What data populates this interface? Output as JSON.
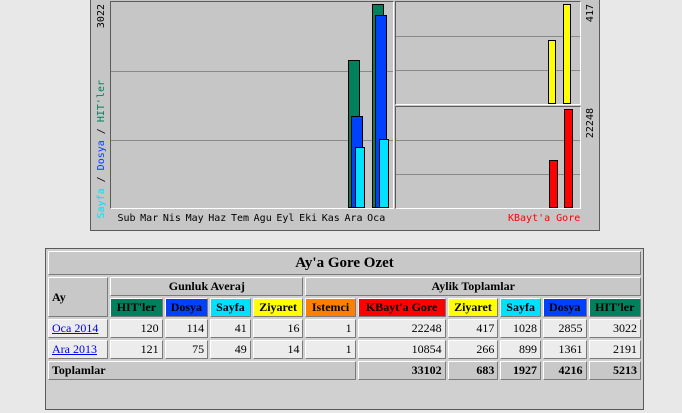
{
  "chart": {
    "months": [
      "Sub",
      "Mar",
      "Nis",
      "May",
      "Haz",
      "Tem",
      "Agu",
      "Eyl",
      "Eki",
      "Kas",
      "Ara",
      "Oca"
    ],
    "left_scale_label": "3022",
    "right_top_scale_label": "417",
    "right_bottom_scale_label": "22248",
    "legend_sayfa": "Sayfa",
    "legend_sep1": " / ",
    "legend_dosya": "Dosya",
    "legend_sep2": " / ",
    "legend_hits": "HIT'ler",
    "legend_kbyte": "KBayt'a Gore"
  },
  "chart_data": [
    {
      "type": "bar",
      "categories": [
        "Ara 2013",
        "Oca 2014"
      ],
      "series": [
        {
          "name": "HIT'ler",
          "values": [
            2191,
            3022
          ],
          "color": "#00805c"
        },
        {
          "name": "Dosya",
          "values": [
            1361,
            2855
          ],
          "color": "#0040ff"
        },
        {
          "name": "Sayfa",
          "values": [
            899,
            1028
          ],
          "color": "#00e0ff"
        }
      ],
      "ylim": [
        0,
        3022
      ]
    },
    {
      "type": "bar",
      "categories": [
        "Ara 2013",
        "Oca 2014"
      ],
      "series": [
        {
          "name": "Ziyaret",
          "values": [
            266,
            417
          ],
          "color": "#ffff00"
        }
      ],
      "ylim": [
        0,
        417
      ]
    },
    {
      "type": "bar",
      "categories": [
        "Ara 2013",
        "Oca 2014"
      ],
      "series": [
        {
          "name": "KBayt'a Gore",
          "values": [
            10854,
            22248
          ],
          "color": "#ff0000"
        }
      ],
      "ylim": [
        0,
        22248
      ]
    }
  ],
  "table": {
    "title": "Ay'a Gore Ozet",
    "month_header": "Ay",
    "daily_header": "Gunluk Averaj",
    "monthly_header": "Aylik Toplamlar",
    "col_hits": "HIT'ler",
    "col_files": "Dosya",
    "col_pages": "Sayfa",
    "col_visits": "Ziyaret",
    "col_sites": "Istemci",
    "col_kbytes": "KBayt'a Gore",
    "rows": [
      {
        "month": "Oca 2014",
        "d_hits": "120",
        "d_files": "114",
        "d_pages": "41",
        "d_visits": "16",
        "sites": "1",
        "kbytes": "22248",
        "visits": "417",
        "pages": "1028",
        "files": "2855",
        "hits": "3022"
      },
      {
        "month": "Ara 2013",
        "d_hits": "121",
        "d_files": "75",
        "d_pages": "49",
        "d_visits": "14",
        "sites": "1",
        "kbytes": "10854",
        "visits": "266",
        "pages": "899",
        "files": "1361",
        "hits": "2191"
      }
    ],
    "totals": {
      "label": "Toplamlar",
      "kbytes": "33102",
      "visits": "683",
      "pages": "1927",
      "files": "4216",
      "hits": "5213"
    }
  },
  "colors": {
    "hits": "#00805c",
    "files": "#0040ff",
    "pages": "#00e0ff",
    "visits": "#ffff00",
    "sites": "#ff8000",
    "kbytes": "#ff0000"
  }
}
